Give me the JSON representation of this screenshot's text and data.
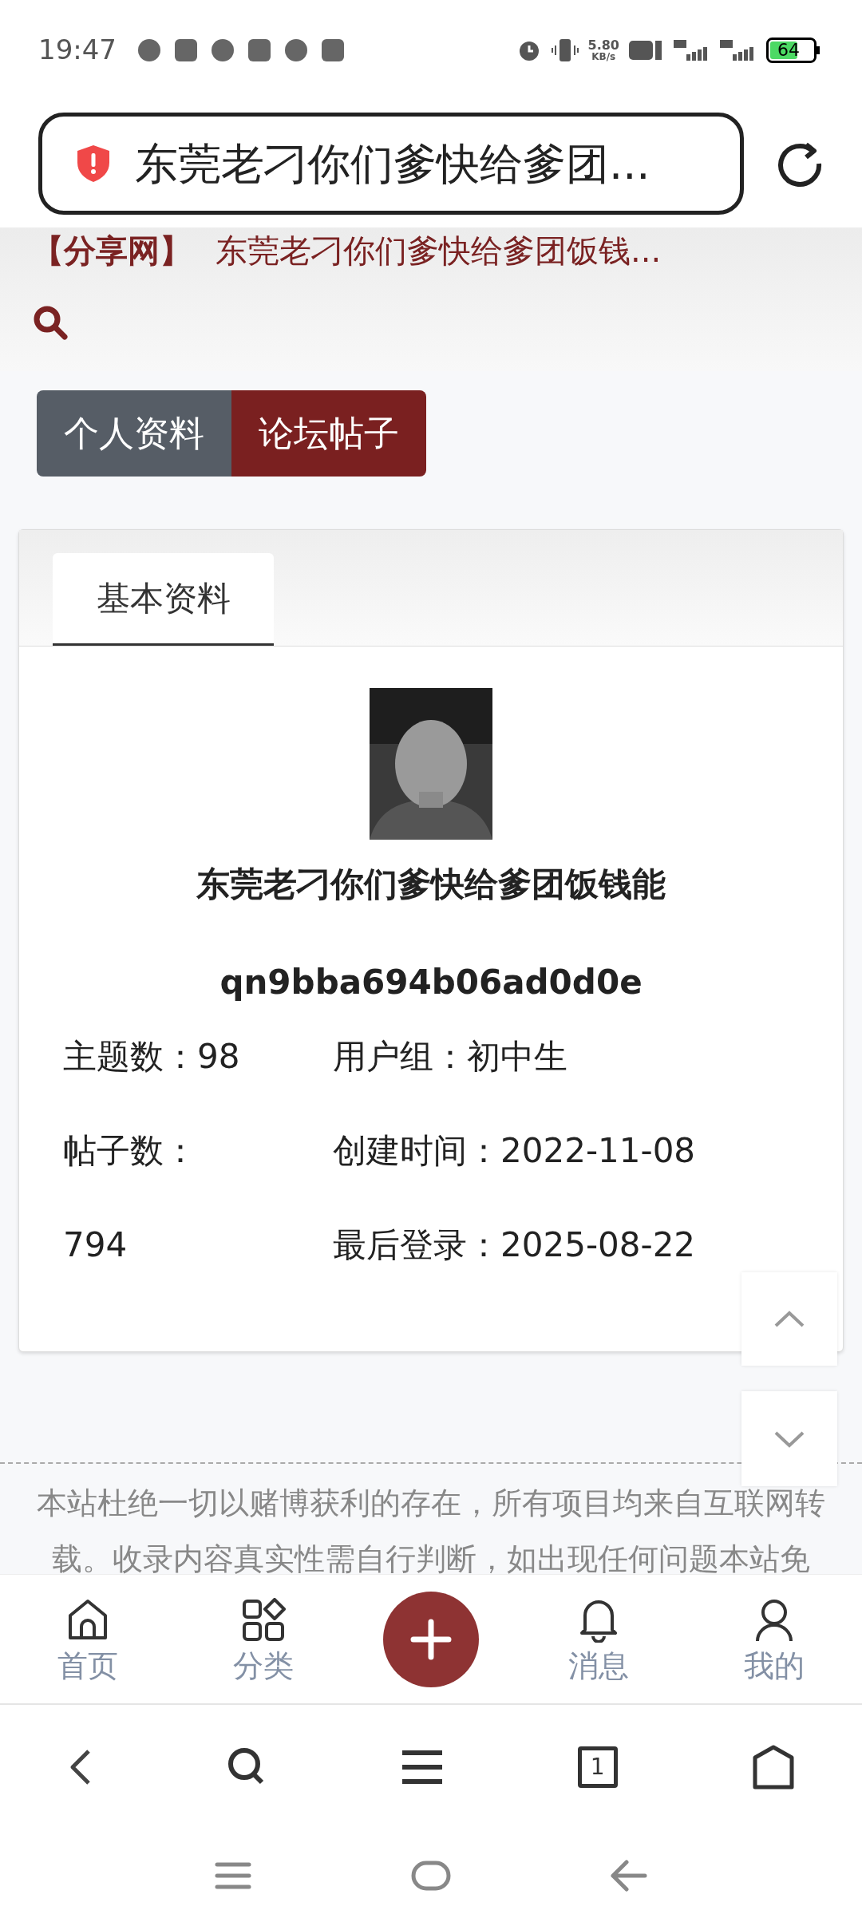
{
  "status_bar": {
    "time": "19:47",
    "net_speed": "5.80",
    "net_unit": "KB/s",
    "battery": "64"
  },
  "address_bar": {
    "title": "东莞老刁你们爹快给爹团..."
  },
  "site_header": {
    "brand": "【分享网】",
    "title": "东莞老刁你们爹快给爹团饭钱..."
  },
  "profile_tabs": [
    {
      "label": "个人资料",
      "selected": false
    },
    {
      "label": "论坛帖子",
      "selected": true
    }
  ],
  "card": {
    "tabs": [
      {
        "label": "基本资料",
        "selected": true
      }
    ],
    "name": "东莞老刁你们爹快给爹团饭钱能",
    "user_id": "qn9bba694b06ad0d0e",
    "stats": [
      "主题数：98",
      "用户组：初中生",
      "帖子数：",
      "创建时间：2022-11-08",
      "794",
      "最后登录：2025-08-22"
    ]
  },
  "footer_text": "本站杜绝一切以赌博获利的存在，所有项目均来自互联网转载。收录内容真实性需自行判断，如出现任何问题本站免",
  "bottom_nav": [
    {
      "kind": "home",
      "label": "首页"
    },
    {
      "kind": "category",
      "label": "分类"
    },
    {
      "kind": "add"
    },
    {
      "kind": "bell",
      "label": "消息"
    },
    {
      "kind": "user",
      "label": "我的"
    }
  ],
  "browser_bar": {
    "tab_count": "1"
  }
}
